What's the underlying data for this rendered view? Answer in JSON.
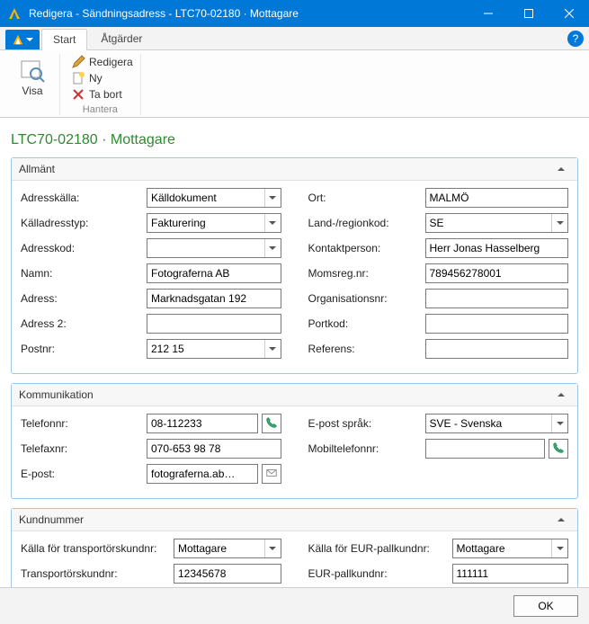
{
  "window": {
    "title": "Redigera - Sändningsadress - LTC70-02180 · Mottagare"
  },
  "ribbon": {
    "tabs": {
      "start": "Start",
      "actions": "Åtgärder"
    },
    "visa": "Visa",
    "redigera": "Redigera",
    "ny": "Ny",
    "tabort": "Ta bort",
    "hantera": "Hantera"
  },
  "page_title": "LTC70-02180 · Mottagare",
  "sections": {
    "allmant": {
      "title": "Allmänt",
      "left": {
        "adresskalla": {
          "label": "Adresskälla:",
          "value": "Källdokument"
        },
        "kalladresstyp": {
          "label": "Källadresstyp:",
          "value": "Fakturering"
        },
        "adresskod": {
          "label": "Adresskod:",
          "value": ""
        },
        "namn": {
          "label": "Namn:",
          "value": "Fotograferna AB"
        },
        "adress": {
          "label": "Adress:",
          "value": "Marknadsgatan 192"
        },
        "adress2": {
          "label": "Adress 2:",
          "value": ""
        },
        "postnr": {
          "label": "Postnr:",
          "value": "212 15"
        }
      },
      "right": {
        "ort": {
          "label": "Ort:",
          "value": "MALMÖ"
        },
        "landregionkod": {
          "label": "Land-/regionkod:",
          "value": "SE"
        },
        "kontaktperson": {
          "label": "Kontaktperson:",
          "value": "Herr Jonas Hasselberg"
        },
        "momsregnr": {
          "label": "Momsreg.nr:",
          "value": "789456278001"
        },
        "organisationsnr": {
          "label": "Organisationsnr:",
          "value": ""
        },
        "portkod": {
          "label": "Portkod:",
          "value": ""
        },
        "referens": {
          "label": "Referens:",
          "value": ""
        }
      }
    },
    "kommunikation": {
      "title": "Kommunikation",
      "left": {
        "telefonnr": {
          "label": "Telefonnr:",
          "value": "08-112233"
        },
        "telefaxnr": {
          "label": "Telefaxnr:",
          "value": "070-653 98 78"
        },
        "epost": {
          "label": "E-post:",
          "value": "fotograferna.ab…"
        }
      },
      "right": {
        "epostsprak": {
          "label": "E-post språk:",
          "value": "SVE - Svenska"
        },
        "mobiltelefonnr": {
          "label": "Mobiltelefonnr:",
          "value": ""
        }
      }
    },
    "kundnummer": {
      "title": "Kundnummer",
      "left": {
        "kallatransport": {
          "label": "Källa för transportörskundnr:",
          "value": "Mottagare"
        },
        "transportkundnr": {
          "label": "Transportörskundnr:",
          "value": "12345678"
        }
      },
      "right": {
        "kallaeur": {
          "label": "Källa för EUR-pallkundnr:",
          "value": "Mottagare"
        },
        "eurpallkundnr": {
          "label": "EUR-pallkundnr:",
          "value": "111111"
        }
      }
    }
  },
  "footer": {
    "ok": "OK"
  }
}
